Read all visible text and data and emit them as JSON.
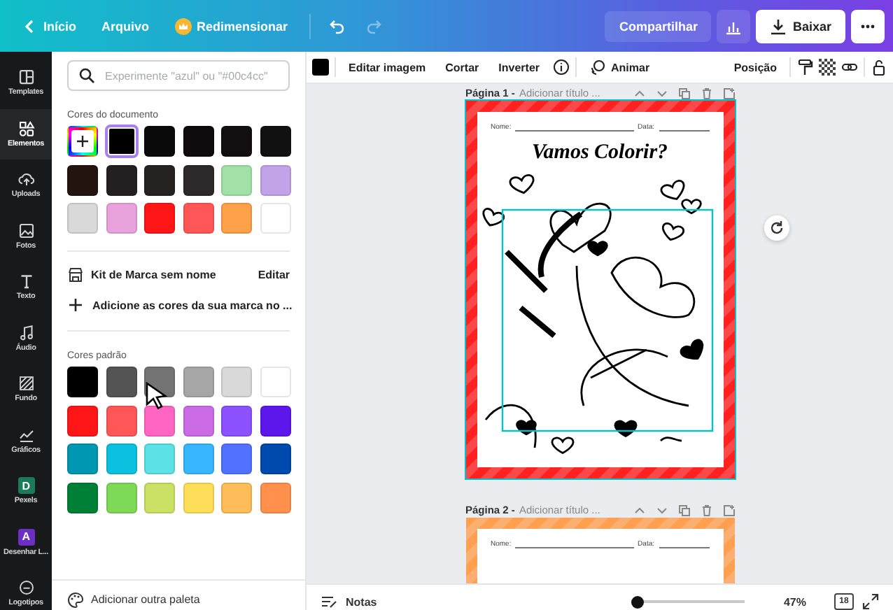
{
  "topbar": {
    "back": "Início",
    "menu": "Arquivo",
    "resize": "Redimensionar",
    "undo": {
      "disabled": false
    },
    "redo": {
      "disabled": true
    },
    "share": "Compartilhar",
    "download": "Baixar"
  },
  "sidebar": {
    "items": [
      {
        "label": "Templates",
        "kind": "tool",
        "selected": false
      },
      {
        "label": "Elementos",
        "kind": "tool",
        "selected": true
      },
      {
        "label": "Uploads",
        "kind": "tool",
        "selected": false
      },
      {
        "label": "Fotos",
        "kind": "tool",
        "selected": false
      },
      {
        "label": "Texto",
        "kind": "tool",
        "selected": false
      },
      {
        "label": "Áudio",
        "kind": "tool",
        "selected": false
      },
      {
        "label": "Fundo",
        "kind": "tool",
        "selected": false
      },
      {
        "label": "Gráficos",
        "kind": "tool",
        "selected": false
      },
      {
        "label": "Pexels",
        "kind": "app",
        "badge": "D",
        "color": "#1b7a5a",
        "selected": false
      },
      {
        "label": "Desenhar L...",
        "kind": "app",
        "badge": "A",
        "color": "#6b2fc4",
        "selected": false
      },
      {
        "label": "Logotipos",
        "kind": "tool",
        "selected": false
      }
    ]
  },
  "panel": {
    "search": {
      "placeholder": "Experimente \"azul\" ou \"#00c4cc\""
    },
    "document_colors": {
      "title": "Cores do documento",
      "swatches": [
        {
          "kind": "add",
          "selected": false
        },
        {
          "kind": "color",
          "color": "#000000",
          "selected": true
        },
        {
          "kind": "color",
          "color": "#0a0a0a",
          "selected": false
        },
        {
          "kind": "color",
          "color": "#0d0b0b",
          "selected": false
        },
        {
          "kind": "color",
          "color": "#110f0f",
          "selected": false
        },
        {
          "kind": "color",
          "color": "#111111",
          "selected": false
        },
        {
          "kind": "color",
          "color": "#24140f",
          "selected": false
        },
        {
          "kind": "color",
          "color": "#222020",
          "selected": false
        },
        {
          "kind": "color",
          "color": "#252222",
          "selected": false
        },
        {
          "kind": "color",
          "color": "#2b2929",
          "selected": false
        },
        {
          "kind": "color",
          "color": "#a3e0a8",
          "selected": false
        },
        {
          "kind": "color",
          "color": "#c3a3e8",
          "selected": false
        },
        {
          "kind": "color",
          "color": "#d9d9d9",
          "selected": false
        },
        {
          "kind": "color",
          "color": "#e8a3dc",
          "selected": false
        },
        {
          "kind": "color",
          "color": "#ff1616",
          "selected": false
        },
        {
          "kind": "color",
          "color": "#ff5757",
          "selected": false
        },
        {
          "kind": "color",
          "color": "#ffa04a",
          "selected": false
        },
        {
          "kind": "color",
          "color": "#ffffff",
          "selected": false
        }
      ]
    },
    "brand_kit": {
      "name": "Kit de Marca sem nome",
      "edit": "Editar",
      "add": "Adicione as cores da sua marca no ..."
    },
    "default_colors": {
      "title": "Cores padrão",
      "swatches": [
        {
          "color": "#000000"
        },
        {
          "color": "#545454"
        },
        {
          "color": "#737373"
        },
        {
          "color": "#a6a6a6"
        },
        {
          "color": "#d9d9d9"
        },
        {
          "color": "#ffffff"
        },
        {
          "color": "#ff1616"
        },
        {
          "color": "#ff5757"
        },
        {
          "color": "#ff66c4"
        },
        {
          "color": "#cb6ce6"
        },
        {
          "color": "#8c52ff"
        },
        {
          "color": "#5e17eb"
        },
        {
          "color": "#0097b2"
        },
        {
          "color": "#0cc0df"
        },
        {
          "color": "#5ce1e6"
        },
        {
          "color": "#38b6ff"
        },
        {
          "color": "#5271ff"
        },
        {
          "color": "#004aad"
        },
        {
          "color": "#008037"
        },
        {
          "color": "#7ed957"
        },
        {
          "color": "#c9e265"
        },
        {
          "color": "#ffde59"
        },
        {
          "color": "#ffbd59"
        },
        {
          "color": "#ff914d"
        }
      ]
    },
    "add_palette": "Adicionar outra paleta"
  },
  "toolbar": {
    "color": "#000000",
    "buttons": [
      "Editar imagem",
      "Cortar",
      "Inverter"
    ],
    "animate": "Animar",
    "position": "Posição"
  },
  "pages": [
    {
      "label": "Página 1 -",
      "title": "Adicionar título ...",
      "color": "#ff2020",
      "name_label": "Nome:",
      "date_label": "Data:",
      "heading": "Vamos Colorir?",
      "selected": true
    },
    {
      "label": "Página 2 -",
      "title": "Adicionar título ...",
      "color": "#ffa050",
      "name_label": "Nome:",
      "date_label": "Data:",
      "selected": false
    }
  ],
  "bottombar": {
    "notes": "Notas",
    "zoom": {
      "level": 0.05
    },
    "zoom_reading": "47%",
    "page_count": "18"
  }
}
